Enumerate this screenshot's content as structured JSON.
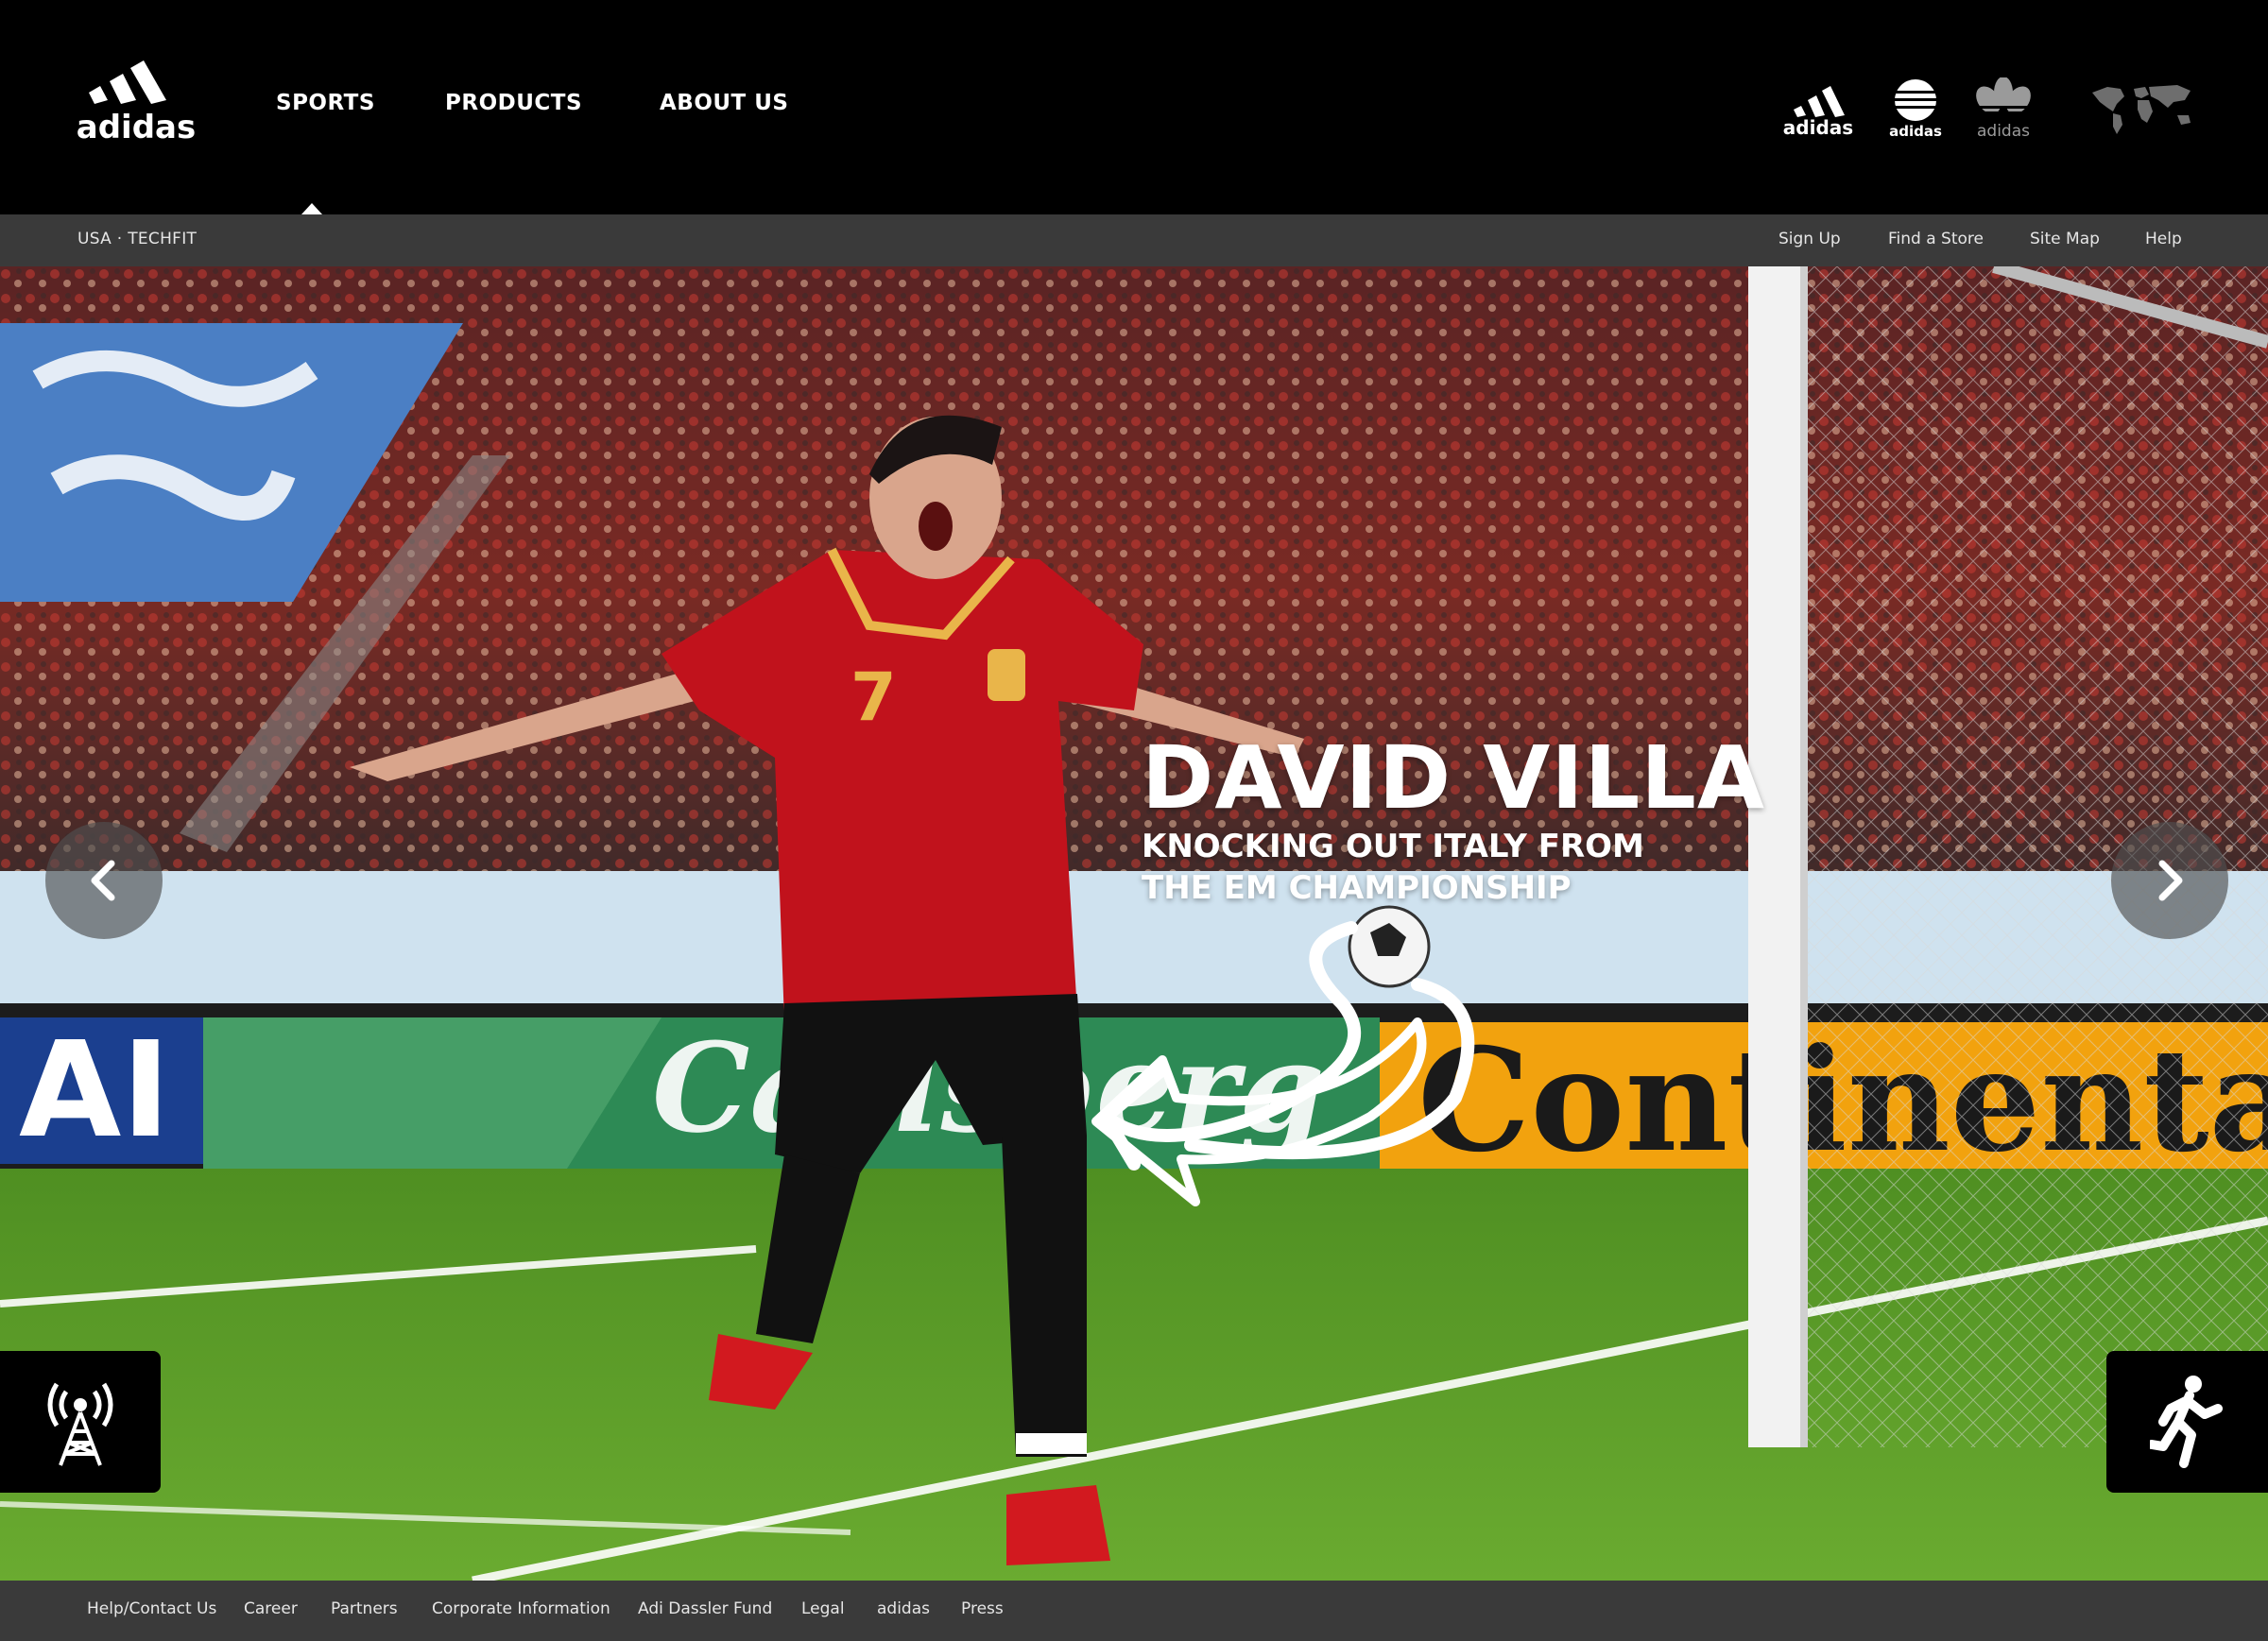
{
  "header": {
    "logo_text": "adidas",
    "nav": [
      {
        "label": "SPORTS"
      },
      {
        "label": "PRODUCTS"
      },
      {
        "label": "ABOUT US"
      }
    ],
    "brands": [
      {
        "label": "adidas",
        "icon": "performance-logo-icon"
      },
      {
        "label": "adidas",
        "icon": "sport-style-logo-icon"
      },
      {
        "label": "adidas",
        "icon": "originals-trefoil-icon"
      }
    ],
    "world_icon": "world-map-icon"
  },
  "subbar": {
    "breadcrumb": "USA · TECHFIT",
    "links": [
      "Sign Up",
      "Find a Store",
      "Site Map",
      "Help"
    ]
  },
  "hero": {
    "title": "DAVID VILLA",
    "subtitle_line1": "KNOCKING OUT ITALY FROM",
    "subtitle_line2": "THE EM CHAMPIONSHIP",
    "prev_icon": "chevron-left-icon",
    "next_icon": "chevron-right-icon",
    "left_icon": "signal-tower-icon",
    "right_icon": "runner-icon",
    "jersey_number": "7",
    "banner_left": "AI",
    "banner_mid": "Carlsberg",
    "banner_right": "Continental"
  },
  "footer": {
    "links": [
      "Help/Contact Us",
      "Career",
      "Partners",
      "Corporate Information",
      "Adi Dassler Fund",
      "Legal",
      "adidas",
      "Press"
    ]
  },
  "colors": {
    "header_bg": "#000000",
    "bar_bg": "#3a3a3a",
    "jersey_red": "#c1121c",
    "pitch_green": "#5c9a2a",
    "banner_yellow": "#f2a20e"
  }
}
